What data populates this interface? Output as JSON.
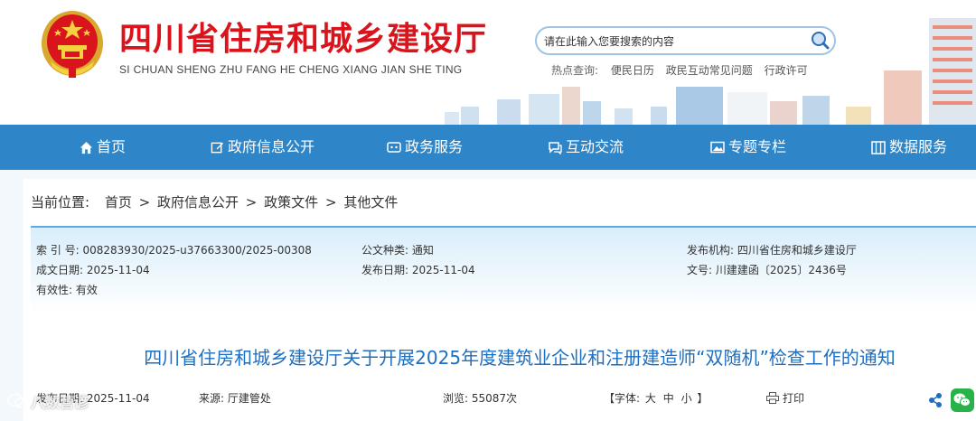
{
  "header": {
    "site_title": "四川省住房和城乡建设厅",
    "site_subtitle": "SI CHUAN SHENG ZHU FANG HE CHENG XIANG JIAN SHE TING",
    "search": {
      "placeholder": "请在此输入您要搜索的内容"
    },
    "hot_label": "热点查询:",
    "hot_links": [
      "便民日历",
      "政民互动常见问题",
      "行政许可"
    ]
  },
  "nav": {
    "items": [
      {
        "label": "首页",
        "icon": "home-icon"
      },
      {
        "label": "政府信息公开",
        "icon": "edit-icon"
      },
      {
        "label": "政务服务",
        "icon": "service-icon"
      },
      {
        "label": "互动交流",
        "icon": "chat-icon"
      },
      {
        "label": "专题专栏",
        "icon": "image-icon"
      },
      {
        "label": "数据服务",
        "icon": "data-icon"
      }
    ]
  },
  "breadcrumb": {
    "label": "当前位置:",
    "items": [
      "首页",
      "政府信息公开",
      "政策文件",
      "其他文件"
    ],
    "separator": ">"
  },
  "info": {
    "index_no": "索 引 号:  008283930/2025-u37663300/2025-00308",
    "doc_type": "公文种类:  通知",
    "issuer": "发布机构:  四川省住房和城乡建设厅",
    "created_date": "成文日期:  2025-11-04",
    "publish_date": "发布日期:  2025-11-04",
    "doc_no": "文号:  川建建函〔2025〕2436号",
    "validity": "有效性:  有效"
  },
  "article": {
    "title": "四川省住房和城乡建设厅关于开展2025年度建筑业企业和注册建造师“双随机”检查工作的通知",
    "meta_date": "发布日期:  2025-11-04",
    "meta_source": "来源:  厅建管处",
    "meta_views": "浏览:  55087次",
    "font_label": "【字体:",
    "font_large": "大",
    "font_medium": "中",
    "font_small": "小",
    "font_close": "】",
    "print_label": "打印"
  },
  "watermark": {
    "text": "八数营谚"
  },
  "colors": {
    "brand_red": "#d9141c",
    "nav_blue": "#2e86c9",
    "title_blue": "#1d6fc2"
  }
}
